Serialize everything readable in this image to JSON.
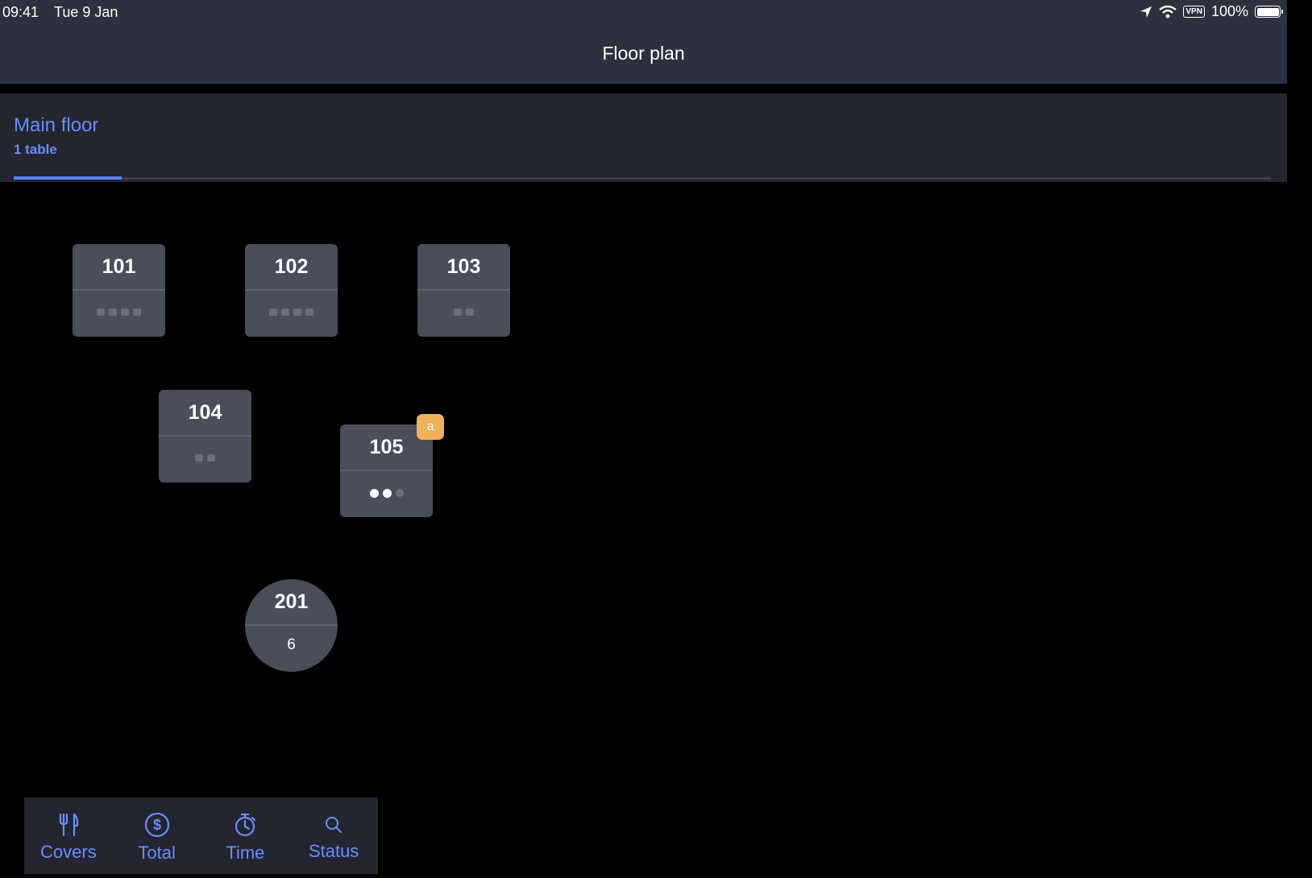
{
  "status_bar": {
    "time": "09:41",
    "date": "Tue 9 Jan",
    "vpn": "VPN",
    "battery": "100%"
  },
  "nav": {
    "title": "Floor plan"
  },
  "section": {
    "name": "Main floor",
    "count": "1 table"
  },
  "tables": [
    {
      "number": "101",
      "shape": "square",
      "seats": 4,
      "occupied": 0
    },
    {
      "number": "102",
      "shape": "square",
      "seats": 4,
      "occupied": 0
    },
    {
      "number": "103",
      "shape": "square",
      "seats": 2,
      "occupied": 0
    },
    {
      "number": "104",
      "shape": "square",
      "seats": 2,
      "occupied": 0
    },
    {
      "number": "105",
      "shape": "square",
      "seats": 3,
      "occupied": 2,
      "badge": "a"
    },
    {
      "number": "201",
      "shape": "round",
      "covers": "6"
    }
  ],
  "toolbar": {
    "covers_label": "Covers",
    "total_label": "Total",
    "time_label": "Time",
    "status_label": "Status"
  },
  "colors": {
    "accent": "#6a8dff",
    "badge": "#f0b158",
    "table": "#4a4d5a",
    "bar": "#2d303e"
  }
}
